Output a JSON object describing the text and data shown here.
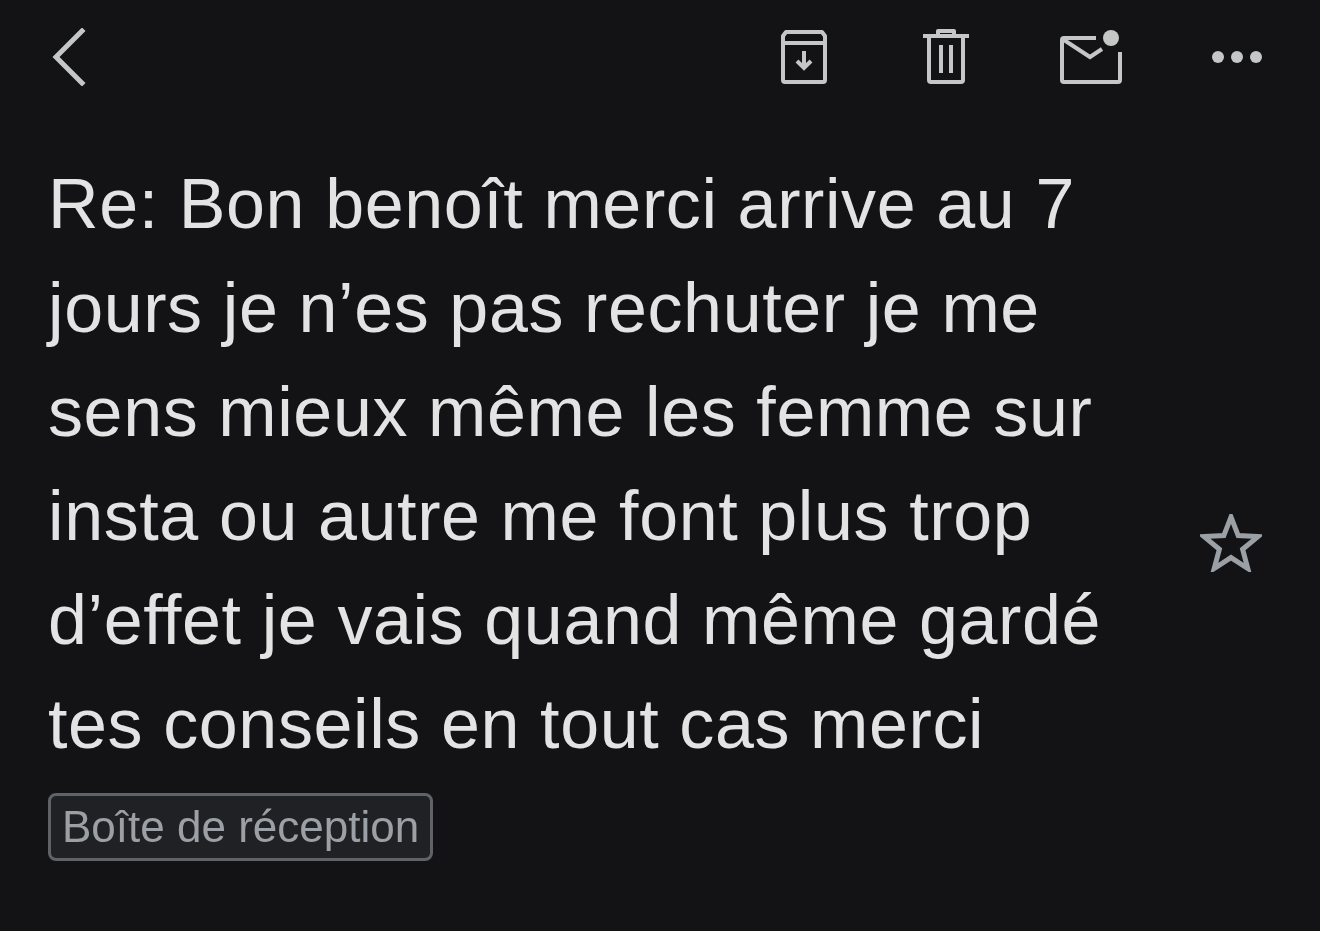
{
  "toolbar": {
    "actions": [
      {
        "kind": "archive"
      },
      {
        "kind": "delete"
      },
      {
        "kind": "mark-unread"
      },
      {
        "kind": "more"
      }
    ]
  },
  "message": {
    "subject": "Re: Bon benoît merci arrive au 7 jours je n’es pas rechuter je me sens mieux même les femme sur insta ou autre me font plus trop d’effet je vais quand même gardé tes conseils en tout cas merci",
    "starred": false,
    "labels": [
      "Boîte de réception"
    ]
  }
}
